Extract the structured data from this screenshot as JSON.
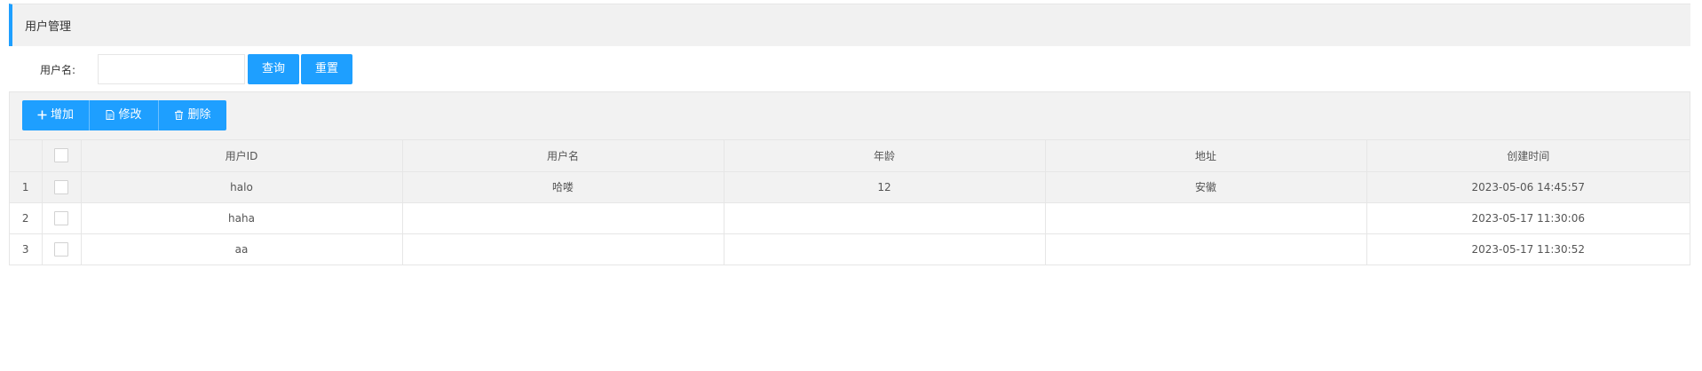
{
  "page": {
    "title": "用户管理"
  },
  "search": {
    "label": "用户名:",
    "value": "",
    "placeholder": "",
    "query_label": "查询",
    "reset_label": "重置"
  },
  "toolbar": {
    "add_label": "增加",
    "edit_label": "修改",
    "delete_label": "删除",
    "add_icon": "plus-icon",
    "edit_icon": "document-icon",
    "delete_icon": "trash-icon"
  },
  "accent_color": "#1e9fff",
  "table": {
    "columns": [
      "用户ID",
      "用户名",
      "年龄",
      "地址",
      "创建时间"
    ],
    "rows": [
      {
        "index": "1",
        "id": "halo",
        "name": "哈喽",
        "age": "12",
        "address": "安徽",
        "created": "2023-05-06 14:45:57"
      },
      {
        "index": "2",
        "id": "haha",
        "name": "",
        "age": "",
        "address": "",
        "created": "2023-05-17 11:30:06"
      },
      {
        "index": "3",
        "id": "aa",
        "name": "",
        "age": "",
        "address": "",
        "created": "2023-05-17 11:30:52"
      }
    ]
  }
}
